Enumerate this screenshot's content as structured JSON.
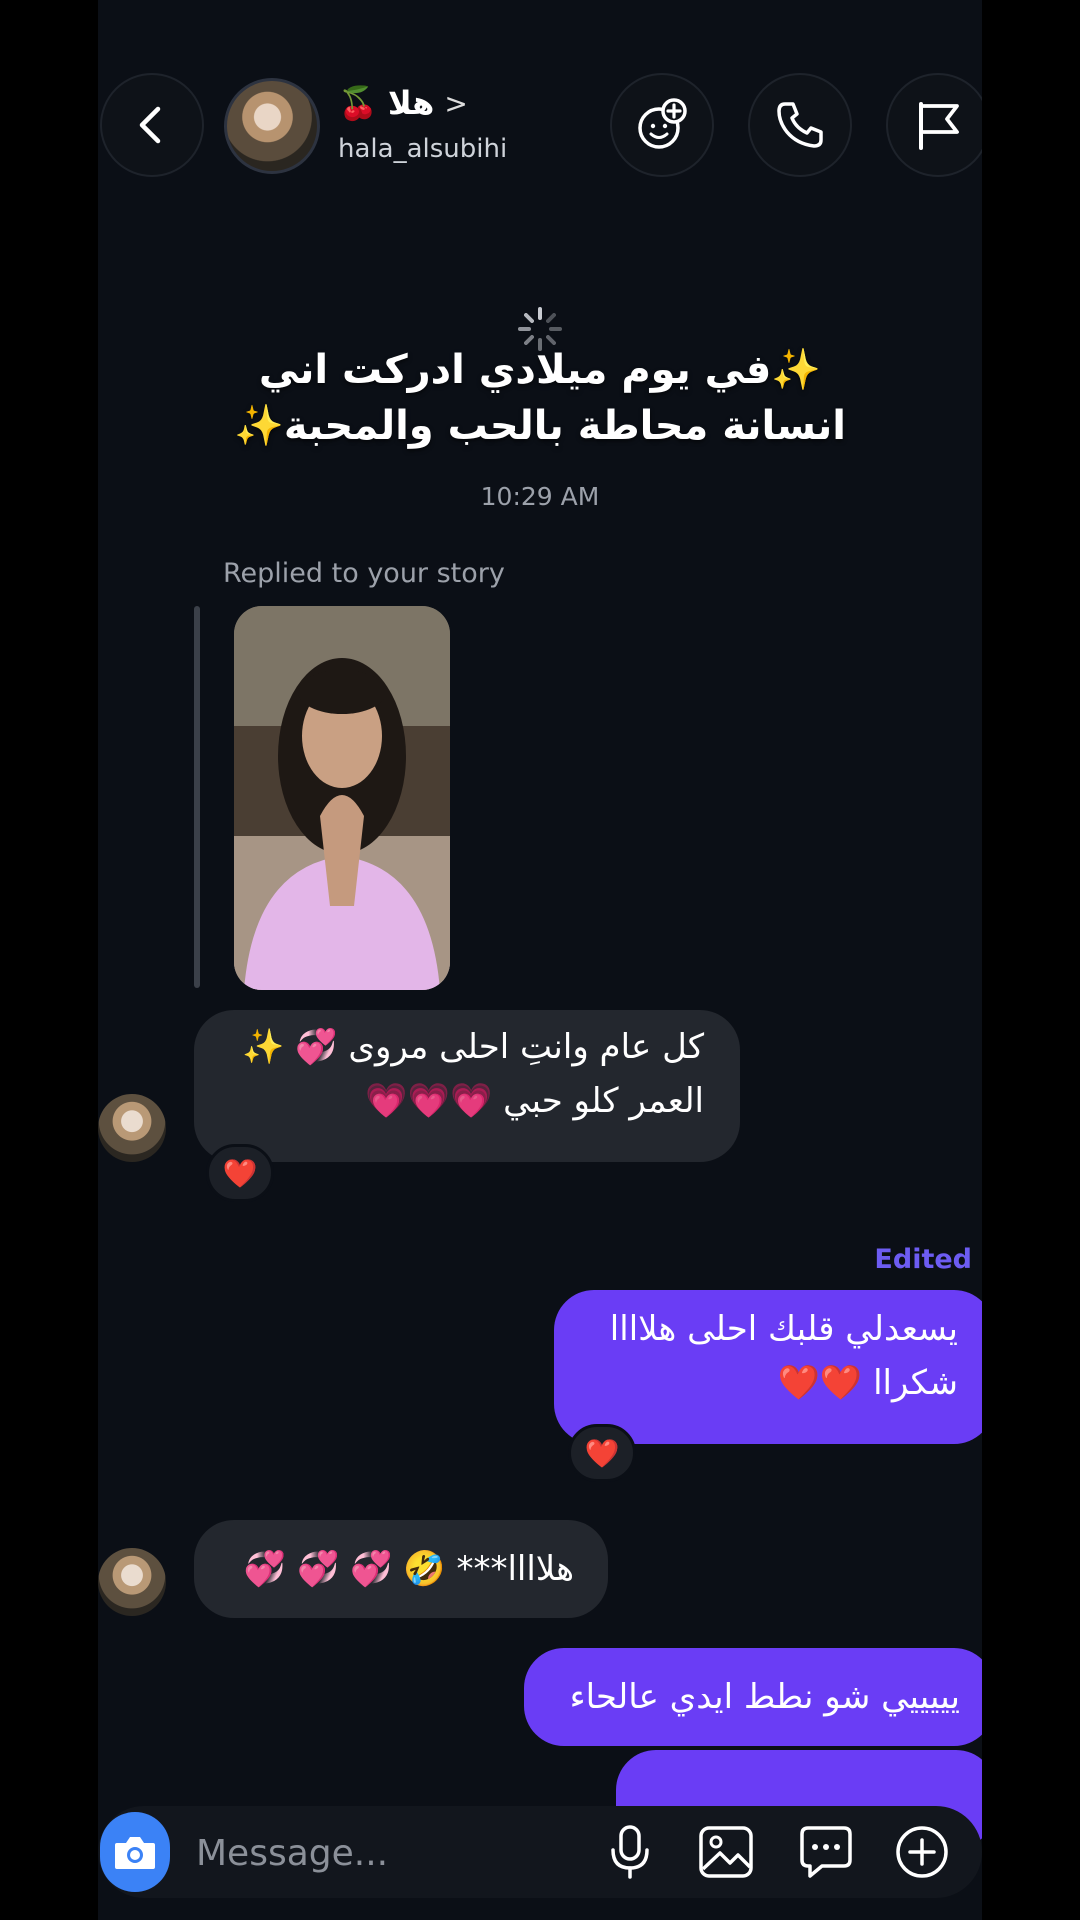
{
  "header": {
    "back_label": "<",
    "contact_name": "هلا",
    "contact_emoji": "🍒",
    "name_chevron": ">",
    "contact_handle": "hala_alsubihi",
    "icons": [
      "back-arrow-icon",
      "effects-icon",
      "phone-icon",
      "flag-icon"
    ]
  },
  "story_reply": {
    "caption_line1": "✨في يوم ميلادي ادركت اني",
    "caption_line2": "انسانة محاطة بالحب والمحبة✨",
    "timestamp": "10:29 AM",
    "replied_label": "Replied to your story"
  },
  "messages": [
    {
      "side": "in",
      "line1": "كل عام وانتِ احلى مروى 💞 ✨",
      "line2": "العمر كلو حبي 💗💗💗",
      "reaction": "❤️"
    },
    {
      "side": "out",
      "edited_label": "Edited",
      "line1": "يسعدلي قلبك احلى هلاااا",
      "line2": "شكراا ❤️❤️",
      "reaction": "❤️"
    },
    {
      "side": "in",
      "text": "هلاااا*** 🤣 💞 💞 💞"
    },
    {
      "side": "out",
      "text": "يييييي شو نطط ايدي عالحاء"
    },
    {
      "side": "out",
      "text": ""
    }
  ],
  "composer": {
    "placeholder": "Message...",
    "icons": [
      "camera-icon",
      "microphone-icon",
      "gallery-icon",
      "sticker-chat-icon",
      "plus-icon"
    ]
  },
  "colors": {
    "background": "#0b0f16",
    "incoming_bubble": "#23272e",
    "outgoing_bubble": "#6a3df5",
    "edited_label": "#6d5cf2",
    "camera_button": "#3b82f6"
  }
}
